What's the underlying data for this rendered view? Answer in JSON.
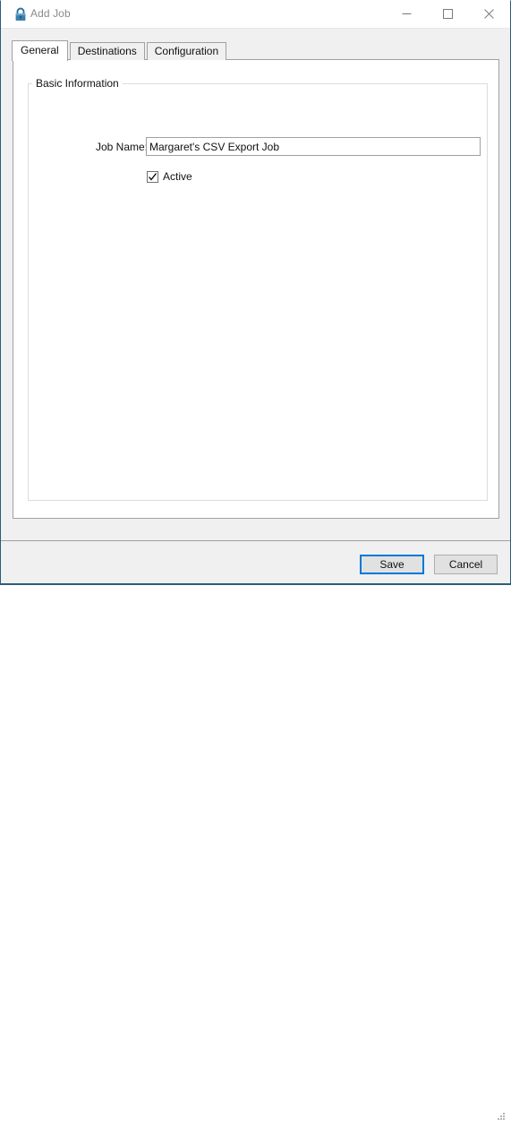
{
  "window": {
    "title": "Add Job",
    "icon": "padlock-icon",
    "accent_blue": "#0078d7",
    "border_color": "#2b5d78",
    "controls": {
      "minimize": "minimize-icon",
      "maximize": "maximize-icon",
      "close": "close-icon"
    }
  },
  "tabs": [
    {
      "label": "General",
      "active": true
    },
    {
      "label": "Destinations",
      "active": false
    },
    {
      "label": "Configuration",
      "active": false
    }
  ],
  "general_tab": {
    "group_title": "Basic Information",
    "job_name": {
      "label": "Job Name:",
      "value": "Margaret's CSV Export Job",
      "placeholder": ""
    },
    "active": {
      "label": "Active",
      "checked": true
    }
  },
  "footer": {
    "save_label": "Save",
    "cancel_label": "Cancel",
    "default_button": "Save",
    "resize_grip": "resize-grip-icon"
  }
}
